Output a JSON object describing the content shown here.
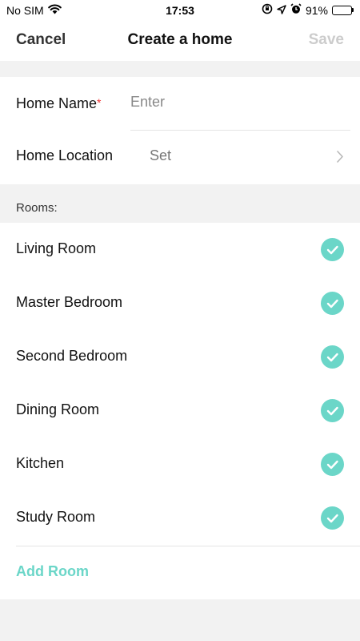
{
  "status_bar": {
    "carrier": "No SIM",
    "time": "17:53",
    "battery_percent": "91%",
    "battery_level": 0.91
  },
  "nav": {
    "cancel_label": "Cancel",
    "title": "Create a home",
    "save_label": "Save"
  },
  "home_form": {
    "name_label": "Home Name",
    "required_mark": "*",
    "name_placeholder": "Enter",
    "name_value": "",
    "location_label": "Home Location",
    "location_value": "Set"
  },
  "rooms": {
    "header": "Rooms:",
    "items": [
      {
        "label": "Living Room",
        "checked": true
      },
      {
        "label": "Master Bedroom",
        "checked": true
      },
      {
        "label": "Second Bedroom",
        "checked": true
      },
      {
        "label": "Dining Room",
        "checked": true
      },
      {
        "label": "Kitchen",
        "checked": true
      },
      {
        "label": "Study Room",
        "checked": true
      }
    ],
    "add_label": "Add Room"
  },
  "colors": {
    "accent": "#6bd6c8",
    "required": "#ee3333",
    "disabled": "#cccccc"
  }
}
